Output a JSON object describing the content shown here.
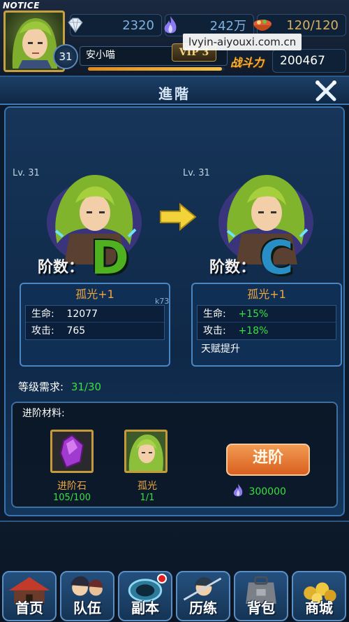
{
  "hud": {
    "notice": "NOTICE",
    "player_level": "31",
    "player_name": "安小喵",
    "exp_fraction": 0.98,
    "vip_label": "VIP 3",
    "power_label": "战斗力",
    "power_value": "200467",
    "resources": {
      "diamond": "2320",
      "energy": "242万",
      "food": "120/120"
    },
    "watermark": "lvyin-aiyouxi.com.cn"
  },
  "title": "進階",
  "upgrade": {
    "current": {
      "level": "Lv. 31",
      "grade_label": "阶数：",
      "grade": "D",
      "name": "孤光+1",
      "hp_label": "生命:",
      "hp_value": "12077",
      "atk_label": "攻击:",
      "atk_value": "765"
    },
    "next": {
      "level": "Lv. 31",
      "grade_label": "阶数：",
      "grade": "C",
      "name": "孤光+1",
      "hp_label": "生命:",
      "hp_value": "+15%",
      "atk_label": "攻击:",
      "atk_value": "+18%",
      "talent": "天赋提升"
    },
    "watermark": "k73"
  },
  "requirement": {
    "label": "等级需求:",
    "value": "31/30"
  },
  "materials": {
    "title": "进阶材料:",
    "items": [
      {
        "name": "进阶石",
        "count": "105/100",
        "icon": "purple-gem-icon"
      },
      {
        "name": "孤光",
        "count": "1/1",
        "icon": "hero-portrait-icon"
      }
    ],
    "advance_button": "进阶",
    "cost": "300000"
  },
  "nav": [
    {
      "label": "首页",
      "icon": "home-icon"
    },
    {
      "label": "队伍",
      "icon": "team-icon"
    },
    {
      "label": "副本",
      "icon": "dungeon-icon"
    },
    {
      "label": "历练",
      "icon": "training-icon"
    },
    {
      "label": "背包",
      "icon": "bag-icon"
    },
    {
      "label": "商城",
      "icon": "shop-icon"
    }
  ],
  "colors": {
    "accent_orange": "#f0a640",
    "positive_green": "#38e040",
    "grade_d": "#4fb020",
    "grade_c": "#2a8ec6"
  }
}
